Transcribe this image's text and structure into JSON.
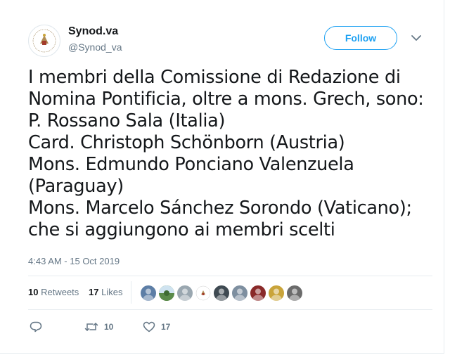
{
  "author": {
    "display_name": "Synod.va",
    "handle": "@Synod_va",
    "avatar_icon": "synod-seal-icon"
  },
  "follow_button": {
    "label": "Follow"
  },
  "menu_icon": "chevron-down-icon",
  "tweet": {
    "text": "I membri della Comissione di Redazione di\nNomina Pontificia, oltre a mons. Grech, sono:\nP. Rossano Sala (Italia)\nCard. Christoph Schönborn (Austria)\nMons. Edmundo Ponciano Valenzuela\n(Paraguay)\nMons. Marcelo Sánchez Sorondo (Vaticano);\nche si aggiungono ai membri scelti",
    "timestamp": "4:43 AM - 15 Oct 2019"
  },
  "stats": {
    "retweets_count": "10",
    "retweets_label": "Retweets",
    "likes_count": "17",
    "likes_label": "Likes"
  },
  "likers": [
    {
      "icon": "user-avatar-icon",
      "color": "#5d7ea6"
    },
    {
      "icon": "landscape-avatar-icon",
      "color": "#5a8a4a"
    },
    {
      "icon": "user-avatar-icon",
      "color": "#9aa7b0"
    },
    {
      "icon": "synod-seal-icon",
      "color": "#ffffff"
    },
    {
      "icon": "user-avatar-icon",
      "color": "#3f4a52"
    },
    {
      "icon": "user-avatar-icon",
      "color": "#7e8fa0"
    },
    {
      "icon": "user-avatar-icon",
      "color": "#8a2a2a"
    },
    {
      "icon": "user-avatar-icon",
      "color": "#c9a43a"
    },
    {
      "icon": "user-avatar-icon",
      "color": "#6b6b6b"
    }
  ],
  "actions": {
    "reply_icon": "reply-icon",
    "retweet_icon": "retweet-icon",
    "retweet_count": "10",
    "like_icon": "heart-icon",
    "like_count": "17"
  },
  "colors": {
    "accent": "#1da1f2",
    "text": "#14171a",
    "muted": "#657786",
    "border": "#e6ecf0"
  }
}
